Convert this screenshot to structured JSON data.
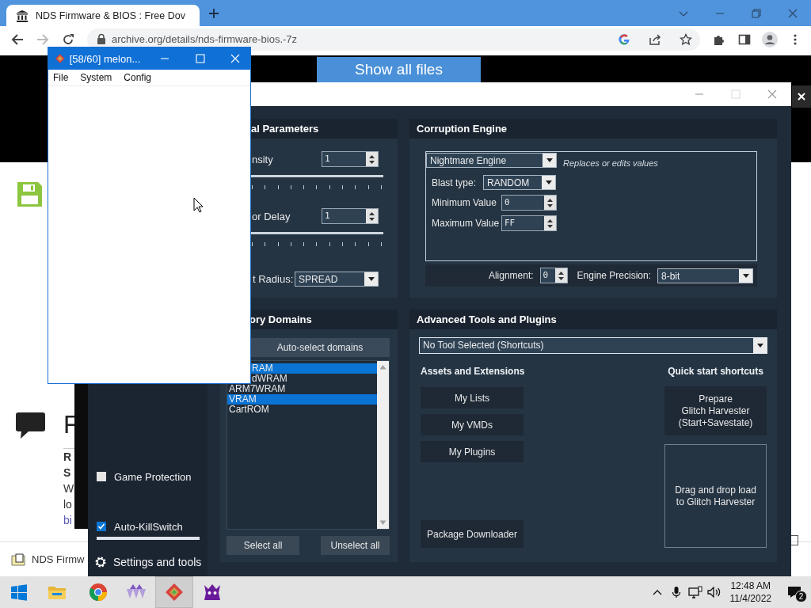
{
  "browser": {
    "tab": {
      "title": "NDS Firmware & BIOS : Free Dov"
    },
    "url": "archive.org/details/nds-firmware-bios.-7z",
    "page": {
      "show_files_button": "Show all files",
      "heading": "F",
      "lines": [
        {
          "text": "R",
          "kind": "bold"
        },
        {
          "text": "S",
          "kind": "bold"
        },
        {
          "text": "W",
          "kind": "plain"
        },
        {
          "text": "lo",
          "kind": "plain"
        },
        {
          "text": "bi",
          "kind": "link"
        }
      ]
    },
    "download": {
      "name": "NDS Firmw"
    }
  },
  "rtc": {
    "sidebar": {
      "options": [
        {
          "label": "Game Protection",
          "checked": false
        },
        {
          "label": "Auto-KillSwitch",
          "checked": true
        }
      ],
      "settings": "Settings and tools"
    },
    "general": {
      "title": "al Parameters",
      "sliders": [
        {
          "label": "nsity",
          "value": "1"
        },
        {
          "label": "or Delay",
          "value": "1"
        }
      ],
      "radius_label": "t Radius:",
      "radius": "SPREAD"
    },
    "engine": {
      "title": "Corruption Engine",
      "engine": "Nightmare Engine",
      "description": "Replaces or edits values",
      "blast_label": "Blast type:",
      "blast": "RANDOM",
      "fields": [
        {
          "label": "Minimum Value",
          "value": "0"
        },
        {
          "label": "Maximum Value",
          "value": "FF"
        }
      ],
      "alignment_label": "Alignment:",
      "alignment": "0",
      "precision_label": "Engine Precision:",
      "precision": "8-bit"
    },
    "domains": {
      "title": "ory Domains",
      "auto_button": "Auto-select domains",
      "items": [
        {
          "label": "RAM",
          "selected": true,
          "kind": "covered"
        },
        {
          "label": "dWRAM",
          "selected": false,
          "kind": "covered"
        },
        {
          "label": "ARM7WRAM",
          "selected": false,
          "kind": "plain"
        },
        {
          "label": "VRAM",
          "selected": true,
          "kind": "plain"
        },
        {
          "label": "CartROM",
          "selected": false,
          "kind": "plain"
        }
      ],
      "buttons": [
        "Select all",
        "Unselect all"
      ]
    },
    "tools": {
      "title": "Advanced Tools and Plugins",
      "tool": "No Tool Selected (Shortcuts)",
      "assets_title": "Assets and Extensions",
      "assets": [
        "My Lists",
        "My VMDs",
        "My Plugins"
      ],
      "package_button": "Package Downloader",
      "quick_title": "Quick start shortcuts",
      "prepare_button": "Prepare\nGlitch Harvester\n(Start+Savestate)",
      "drop_zone": "Drag and drop load\nto Glitch Harvester"
    }
  },
  "melon": {
    "title": "[58/60] melon...",
    "menu": [
      "File",
      "System",
      "Config"
    ]
  },
  "taskbar": {
    "apps": [
      {
        "kind": "start",
        "selected": false
      },
      {
        "kind": "folder",
        "selected": false
      },
      {
        "kind": "chrome",
        "selected": false
      },
      {
        "kind": "triangles",
        "selected": false
      },
      {
        "kind": "diamond",
        "selected": true
      },
      {
        "kind": "monster",
        "selected": false
      }
    ],
    "clock": {
      "time": "12:48 AM",
      "date": "11/4/2022"
    },
    "notifications": "2"
  }
}
